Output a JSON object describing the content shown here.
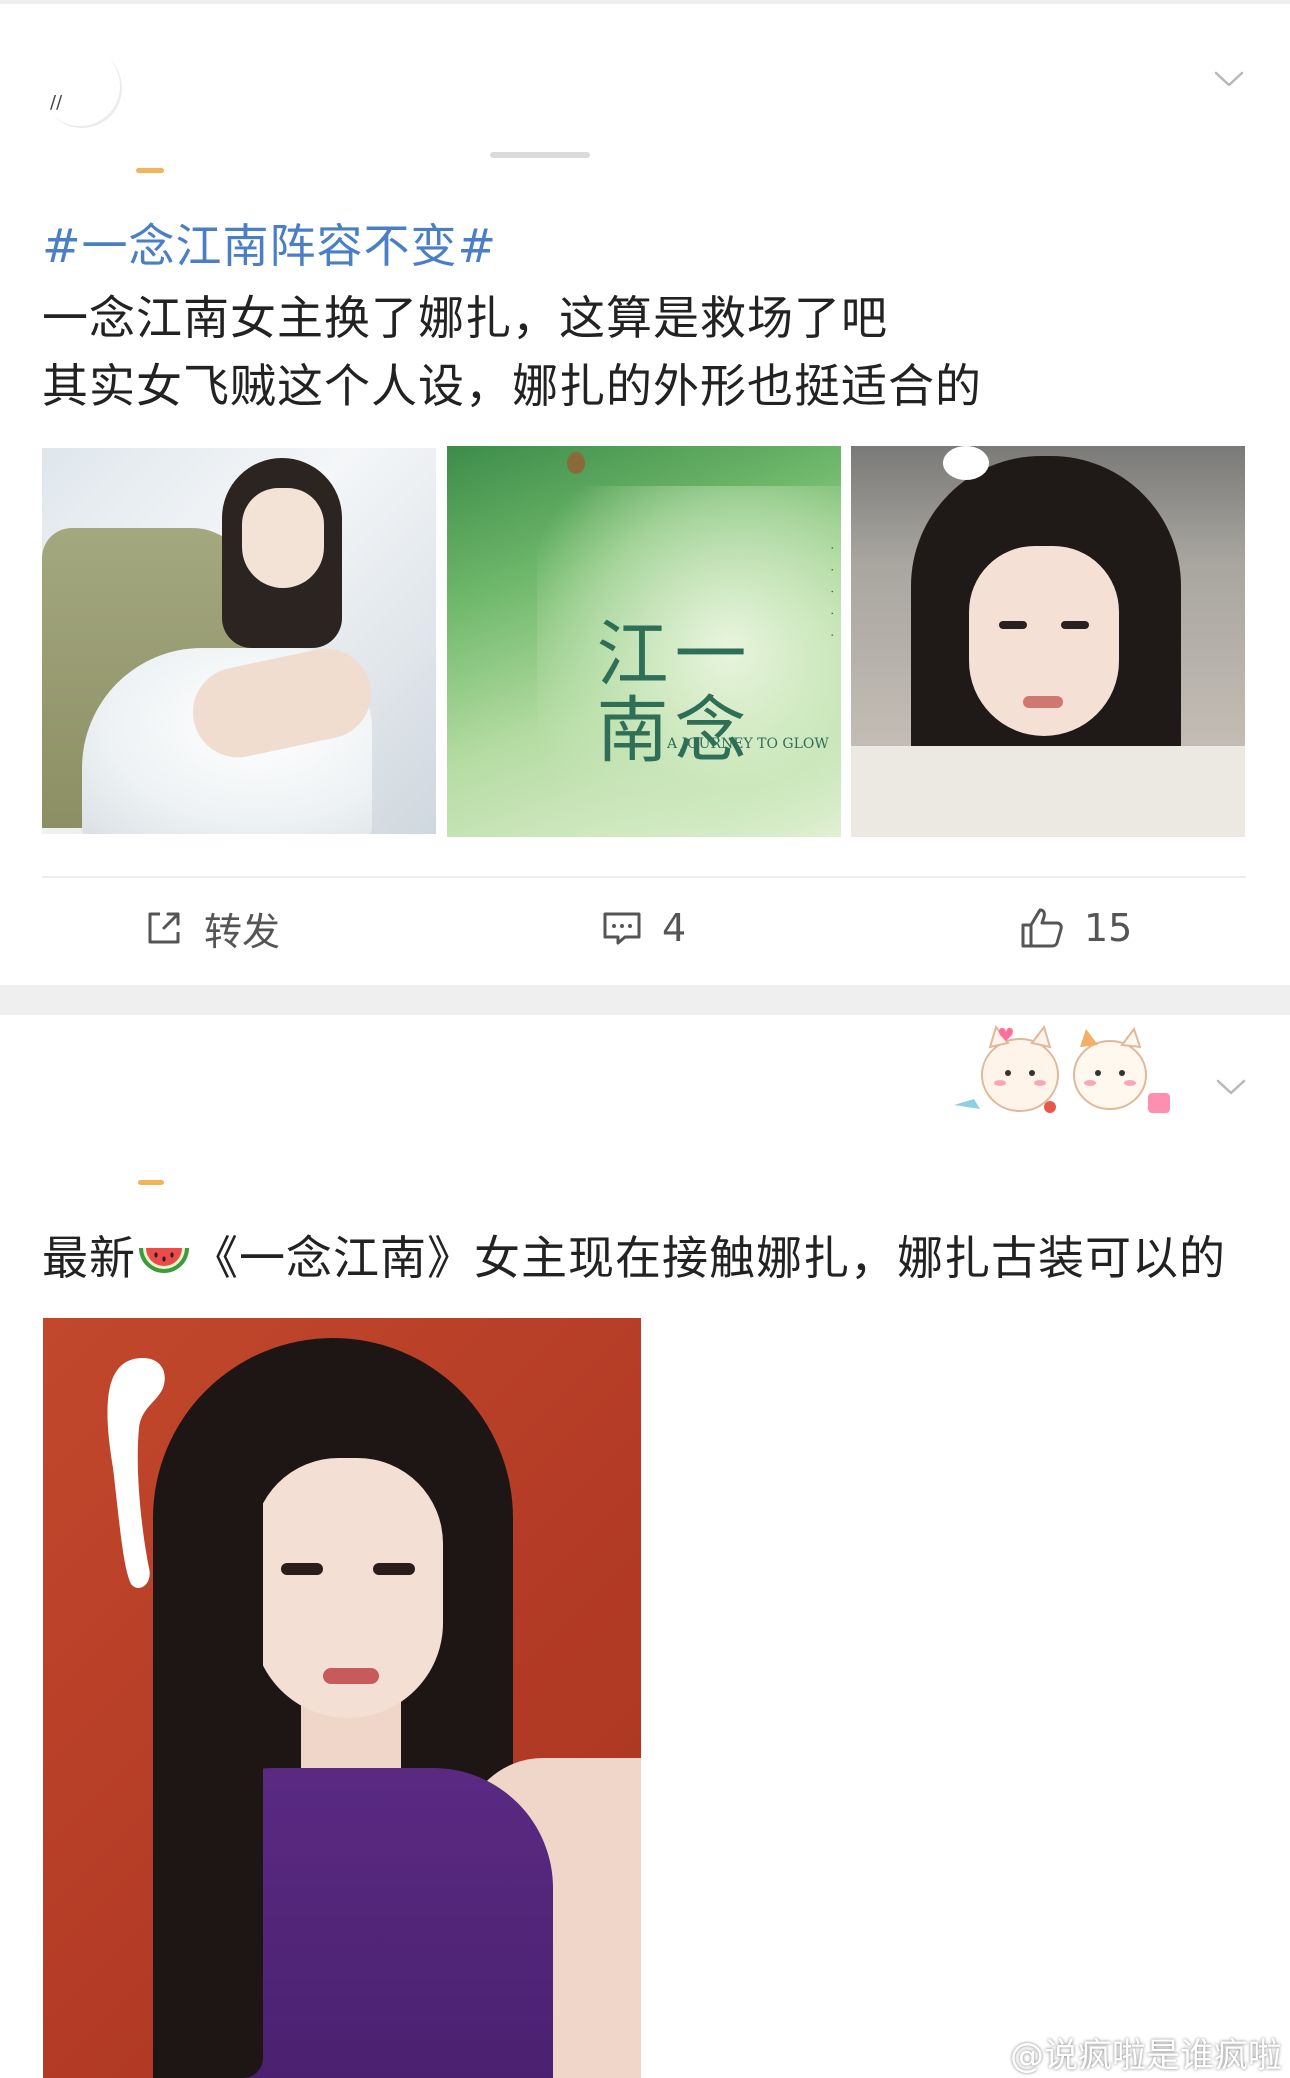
{
  "post1": {
    "hashtag": "#一念江南阵容不变#",
    "text_line1": "一念江南女主换了娜扎，这算是救场了吧",
    "text_line2": "其实女飞贼这个人设，娜扎的外形也挺适合的",
    "images": [
      {
        "name": "nazha-white-dress-photo"
      },
      {
        "name": "yinian-jiangnan-poster",
        "title": "一念江南",
        "subtitle": "A JOURNEY TO GLOW"
      },
      {
        "name": "nazha-costume-photo"
      }
    ],
    "actions": {
      "repost_label": "转发",
      "comment_count": "4",
      "like_count": "15"
    }
  },
  "post2": {
    "text_before": "最新",
    "text_after": "《一念江南》女主现在接触娜扎，娜扎古装可以的",
    "image": {
      "name": "nazha-purple-top-photo"
    }
  },
  "watermark": {
    "text": "@说疯啦是谁疯啦"
  },
  "colors": {
    "hashtag": "#4a7fc5",
    "text": "#222222",
    "action": "#555555",
    "separator": "#efefef"
  }
}
